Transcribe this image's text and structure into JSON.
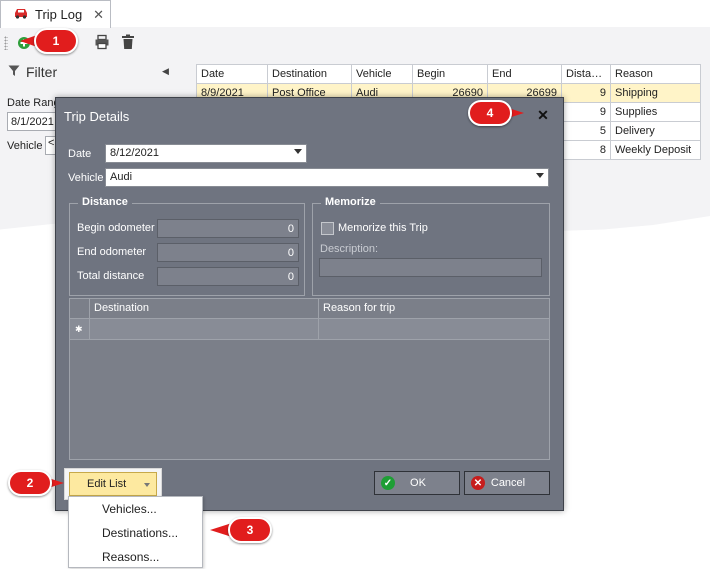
{
  "tab": {
    "title": "Trip Log",
    "close": "✕"
  },
  "toolbar": {
    "add_icon": "plus-circle-icon",
    "print_icon": "printer-icon",
    "delete_icon": "trash-icon"
  },
  "filter": {
    "title": "Filter",
    "collapse_glyph": "◀",
    "date_range_label": "Date Range",
    "date_range_value": "8/1/2021",
    "vehicle_label": "Vehicle",
    "vehicle_value": "<"
  },
  "trip_table": {
    "headers": [
      "Date",
      "Destination",
      "Vehicle",
      "Begin",
      "End",
      "Distan...",
      "Reason"
    ],
    "rows": [
      [
        "8/9/2021",
        "Post Office",
        "Audi",
        "26690",
        "26699",
        "9",
        "Shipping"
      ],
      [
        "",
        "",
        "",
        "",
        "",
        "9",
        "Supplies"
      ],
      [
        "",
        "",
        "",
        "",
        "",
        "5",
        "Delivery"
      ],
      [
        "",
        "",
        "",
        "",
        "",
        "8",
        "Weekly Deposit"
      ]
    ]
  },
  "dialog": {
    "title": "Trip Details",
    "close": "✕",
    "date_label": "Date",
    "date_value": "8/12/2021",
    "vehicle_label": "Vehicle",
    "vehicle_value": "Audi",
    "distance": {
      "legend": "Distance",
      "begin_label": "Begin odometer",
      "begin_value": "0",
      "end_label": "End odometer",
      "end_value": "0",
      "total_label": "Total distance",
      "total_value": "0"
    },
    "memorize": {
      "legend": "Memorize",
      "checkbox_label": "Memorize this Trip",
      "description_label": "Description:"
    },
    "grid": {
      "col_destination": "Destination",
      "col_reason": "Reason for trip",
      "new_row_marker": "✱"
    },
    "edit_list_label": "Edit List",
    "ok_label": "OK",
    "cancel_label": "Cancel"
  },
  "edit_menu": {
    "items": [
      "Vehicles...",
      "Destinations...",
      "Reasons..."
    ]
  },
  "callouts": [
    "1",
    "2",
    "3",
    "4"
  ],
  "colors": {
    "callout": "#e11d1d",
    "dialog_bg": "#6f7480",
    "edit_list_bg": "#fde9a0",
    "selected_row": "#fff4c8"
  }
}
